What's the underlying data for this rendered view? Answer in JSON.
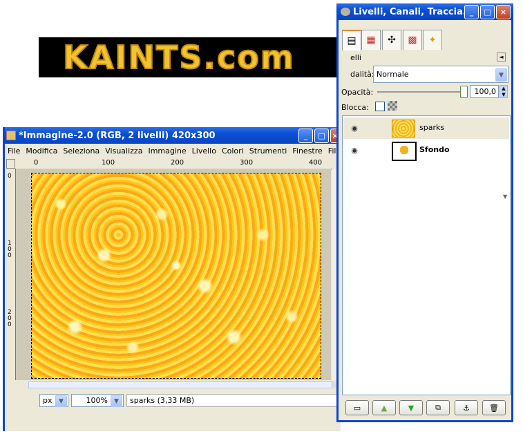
{
  "logo": {
    "text": "KAINTS.com"
  },
  "image_window": {
    "title": "*Immagine-2.0 (RGB, 2 livelli) 420x300",
    "menu": [
      "File",
      "Modifica",
      "Seleziona",
      "Visualizza",
      "Immagine",
      "Livello",
      "Colori",
      "Strumenti",
      "Finestre",
      "Filtri"
    ],
    "hruler": [
      "0",
      "100",
      "200",
      "300",
      "400"
    ],
    "vruler": [
      "0",
      "1\n0\n0",
      "2\n0\n0"
    ],
    "unit": "px",
    "zoom": "100%",
    "status": "sparks (3,33 MB)"
  },
  "dock": {
    "title": "Livelli, Canali, Traccia...",
    "panel_label": "elli",
    "mode_label": "dalità:",
    "mode_value": "Normale",
    "opacity_label": "Opacità:",
    "opacity_value": "100,0",
    "opacity": 1.0,
    "lock_label": "Blocca:",
    "layers": [
      {
        "name": "sparks",
        "visible": true,
        "selected": true
      },
      {
        "name": "Sfondo",
        "visible": true,
        "selected": false
      }
    ]
  },
  "colors": {
    "titlebar": "#0a46d2",
    "selection": "#ece9d8",
    "spark": "#ffbe26"
  }
}
